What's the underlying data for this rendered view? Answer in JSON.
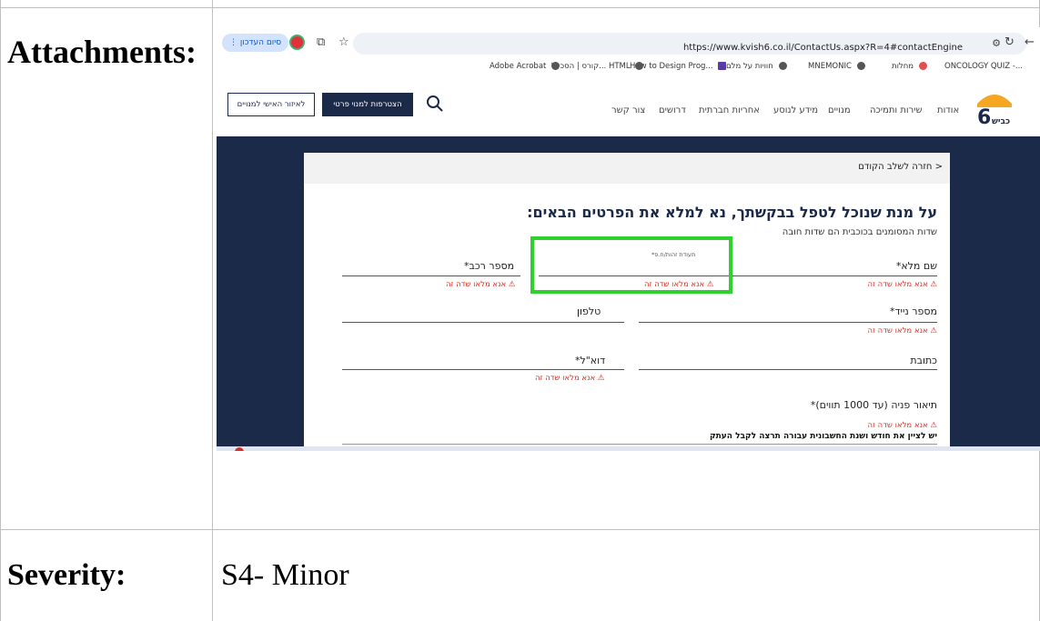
{
  "document": {
    "attachments_label": "Attachments:",
    "severity_label": "Severity:",
    "severity_value": "S4- Minor"
  },
  "browser": {
    "update_chip": "סיום העדכון",
    "url": "https://www.kvish6.co.il/ContactUs.aspx?R=4#contactEngine",
    "bookmarks": [
      "ONCOLOGY QUIZ -...",
      "מחלות",
      "MNEMONIC",
      "חוויות על מלם",
      "How to Design Prog...",
      "קורס | הסכלל... HTML",
      "Adobe Acrobat"
    ]
  },
  "site": {
    "personal_area_button": "לאיזור האישי למנויים",
    "join_button": "הצטרפות למנוי פרטי",
    "nav": [
      "אודות",
      "שירות ותמיכה",
      "מנויים",
      "מידע לנוסע",
      "אחריות חברתית",
      "דרושים",
      "צור קשר"
    ],
    "logo_text": "כביש 6"
  },
  "form": {
    "back_link": "< חזרה לשלב הקודם",
    "title": "על מנת שנוכל לטפל בבקשתך, נא למלא את הפרטים הבאים:",
    "subtitle": "שדות המסומנים בכוכבית הם שדות חובה",
    "full_name_label": "שם מלא*",
    "id_label_small": "תעודת זהות/ח.פ*",
    "car_number_label": "מספר רכב*",
    "mobile_label": "מספר נייד*",
    "phone_label": "טלפון",
    "address_label": "כתובת",
    "email_label": "דוא\"ל*",
    "description_label": "תיאור פניה (עד 1000 תווים)*",
    "error_text": "⚠ אנא מלאו שדה זה",
    "description_hint": "יש לציין את חודש ושנת החשבונית עבורה תרצה לקבל העתק"
  }
}
